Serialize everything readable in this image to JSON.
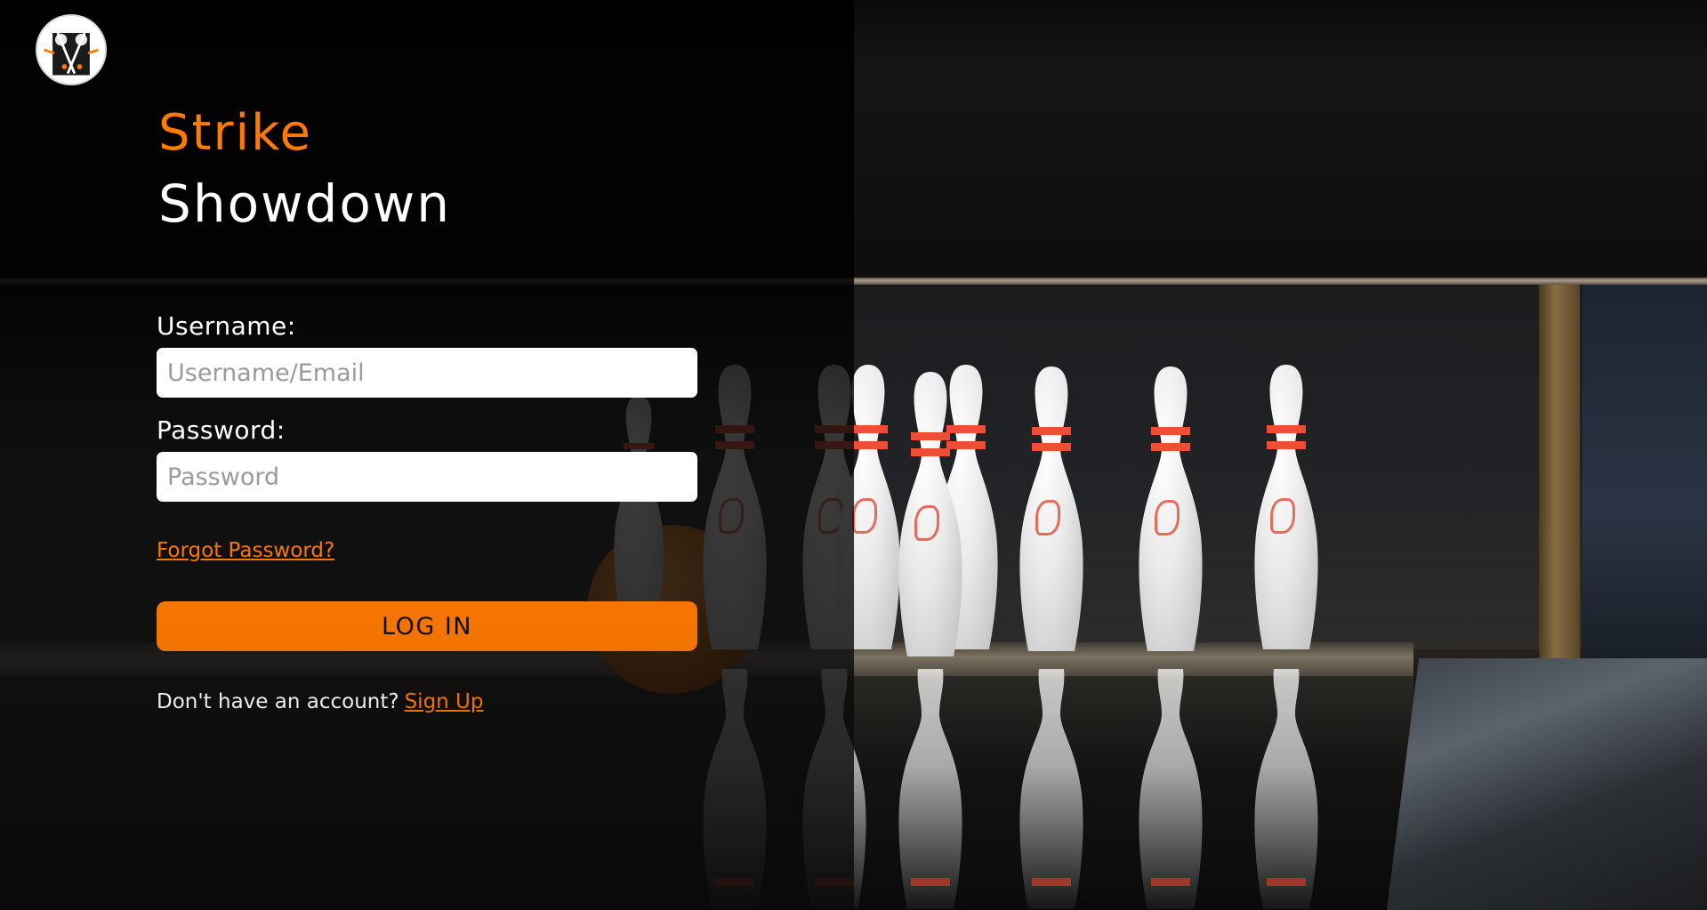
{
  "brand": {
    "logo_icon": "bowling-duo-logo-icon",
    "title_line1": "Strike",
    "title_line2": "Showdown",
    "accent_color": "#ff7a00"
  },
  "login_form": {
    "username_label": "Username:",
    "username_placeholder": "Username/Email",
    "username_value": "",
    "password_label": "Password:",
    "password_placeholder": "Password",
    "password_value": "",
    "forgot_password_link": "Forgot Password?",
    "login_button": "LOG IN",
    "signup_prompt": "Don't have an account?",
    "signup_link": "Sign Up"
  },
  "background": {
    "scene": "bowling-pins-image"
  }
}
